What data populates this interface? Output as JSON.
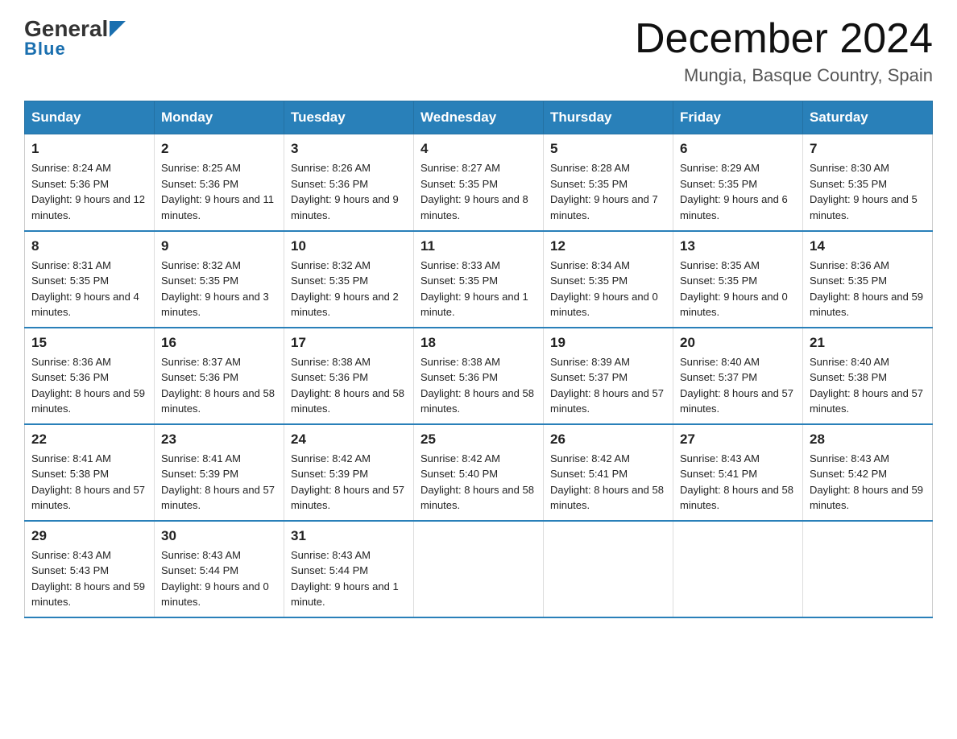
{
  "header": {
    "logo_general": "General",
    "logo_blue": "Blue",
    "month_title": "December 2024",
    "location": "Mungia, Basque Country, Spain"
  },
  "days_of_week": [
    "Sunday",
    "Monday",
    "Tuesday",
    "Wednesday",
    "Thursday",
    "Friday",
    "Saturday"
  ],
  "weeks": [
    [
      {
        "day": "1",
        "sunrise": "8:24 AM",
        "sunset": "5:36 PM",
        "daylight": "9 hours and 12 minutes."
      },
      {
        "day": "2",
        "sunrise": "8:25 AM",
        "sunset": "5:36 PM",
        "daylight": "9 hours and 11 minutes."
      },
      {
        "day": "3",
        "sunrise": "8:26 AM",
        "sunset": "5:36 PM",
        "daylight": "9 hours and 9 minutes."
      },
      {
        "day": "4",
        "sunrise": "8:27 AM",
        "sunset": "5:35 PM",
        "daylight": "9 hours and 8 minutes."
      },
      {
        "day": "5",
        "sunrise": "8:28 AM",
        "sunset": "5:35 PM",
        "daylight": "9 hours and 7 minutes."
      },
      {
        "day": "6",
        "sunrise": "8:29 AM",
        "sunset": "5:35 PM",
        "daylight": "9 hours and 6 minutes."
      },
      {
        "day": "7",
        "sunrise": "8:30 AM",
        "sunset": "5:35 PM",
        "daylight": "9 hours and 5 minutes."
      }
    ],
    [
      {
        "day": "8",
        "sunrise": "8:31 AM",
        "sunset": "5:35 PM",
        "daylight": "9 hours and 4 minutes."
      },
      {
        "day": "9",
        "sunrise": "8:32 AM",
        "sunset": "5:35 PM",
        "daylight": "9 hours and 3 minutes."
      },
      {
        "day": "10",
        "sunrise": "8:32 AM",
        "sunset": "5:35 PM",
        "daylight": "9 hours and 2 minutes."
      },
      {
        "day": "11",
        "sunrise": "8:33 AM",
        "sunset": "5:35 PM",
        "daylight": "9 hours and 1 minute."
      },
      {
        "day": "12",
        "sunrise": "8:34 AM",
        "sunset": "5:35 PM",
        "daylight": "9 hours and 0 minutes."
      },
      {
        "day": "13",
        "sunrise": "8:35 AM",
        "sunset": "5:35 PM",
        "daylight": "9 hours and 0 minutes."
      },
      {
        "day": "14",
        "sunrise": "8:36 AM",
        "sunset": "5:35 PM",
        "daylight": "8 hours and 59 minutes."
      }
    ],
    [
      {
        "day": "15",
        "sunrise": "8:36 AM",
        "sunset": "5:36 PM",
        "daylight": "8 hours and 59 minutes."
      },
      {
        "day": "16",
        "sunrise": "8:37 AM",
        "sunset": "5:36 PM",
        "daylight": "8 hours and 58 minutes."
      },
      {
        "day": "17",
        "sunrise": "8:38 AM",
        "sunset": "5:36 PM",
        "daylight": "8 hours and 58 minutes."
      },
      {
        "day": "18",
        "sunrise": "8:38 AM",
        "sunset": "5:36 PM",
        "daylight": "8 hours and 58 minutes."
      },
      {
        "day": "19",
        "sunrise": "8:39 AM",
        "sunset": "5:37 PM",
        "daylight": "8 hours and 57 minutes."
      },
      {
        "day": "20",
        "sunrise": "8:40 AM",
        "sunset": "5:37 PM",
        "daylight": "8 hours and 57 minutes."
      },
      {
        "day": "21",
        "sunrise": "8:40 AM",
        "sunset": "5:38 PM",
        "daylight": "8 hours and 57 minutes."
      }
    ],
    [
      {
        "day": "22",
        "sunrise": "8:41 AM",
        "sunset": "5:38 PM",
        "daylight": "8 hours and 57 minutes."
      },
      {
        "day": "23",
        "sunrise": "8:41 AM",
        "sunset": "5:39 PM",
        "daylight": "8 hours and 57 minutes."
      },
      {
        "day": "24",
        "sunrise": "8:42 AM",
        "sunset": "5:39 PM",
        "daylight": "8 hours and 57 minutes."
      },
      {
        "day": "25",
        "sunrise": "8:42 AM",
        "sunset": "5:40 PM",
        "daylight": "8 hours and 58 minutes."
      },
      {
        "day": "26",
        "sunrise": "8:42 AM",
        "sunset": "5:41 PM",
        "daylight": "8 hours and 58 minutes."
      },
      {
        "day": "27",
        "sunrise": "8:43 AM",
        "sunset": "5:41 PM",
        "daylight": "8 hours and 58 minutes."
      },
      {
        "day": "28",
        "sunrise": "8:43 AM",
        "sunset": "5:42 PM",
        "daylight": "8 hours and 59 minutes."
      }
    ],
    [
      {
        "day": "29",
        "sunrise": "8:43 AM",
        "sunset": "5:43 PM",
        "daylight": "8 hours and 59 minutes."
      },
      {
        "day": "30",
        "sunrise": "8:43 AM",
        "sunset": "5:44 PM",
        "daylight": "9 hours and 0 minutes."
      },
      {
        "day": "31",
        "sunrise": "8:43 AM",
        "sunset": "5:44 PM",
        "daylight": "9 hours and 1 minute."
      },
      null,
      null,
      null,
      null
    ]
  ]
}
